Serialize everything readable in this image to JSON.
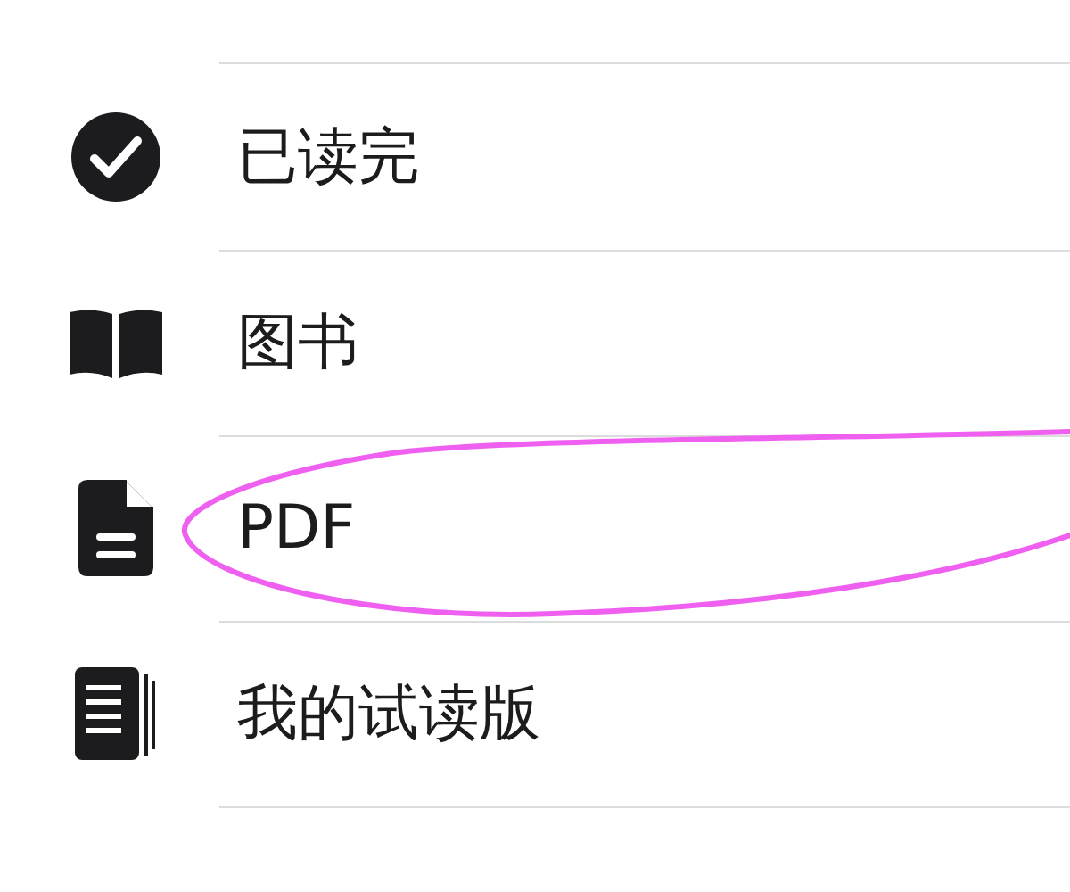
{
  "menu": {
    "items": [
      {
        "kind": "check",
        "label": "已读完"
      },
      {
        "kind": "book",
        "label": "图书"
      },
      {
        "kind": "document",
        "label": "PDF",
        "annotated": true
      },
      {
        "kind": "pages",
        "label": "我的试读版"
      }
    ]
  }
}
